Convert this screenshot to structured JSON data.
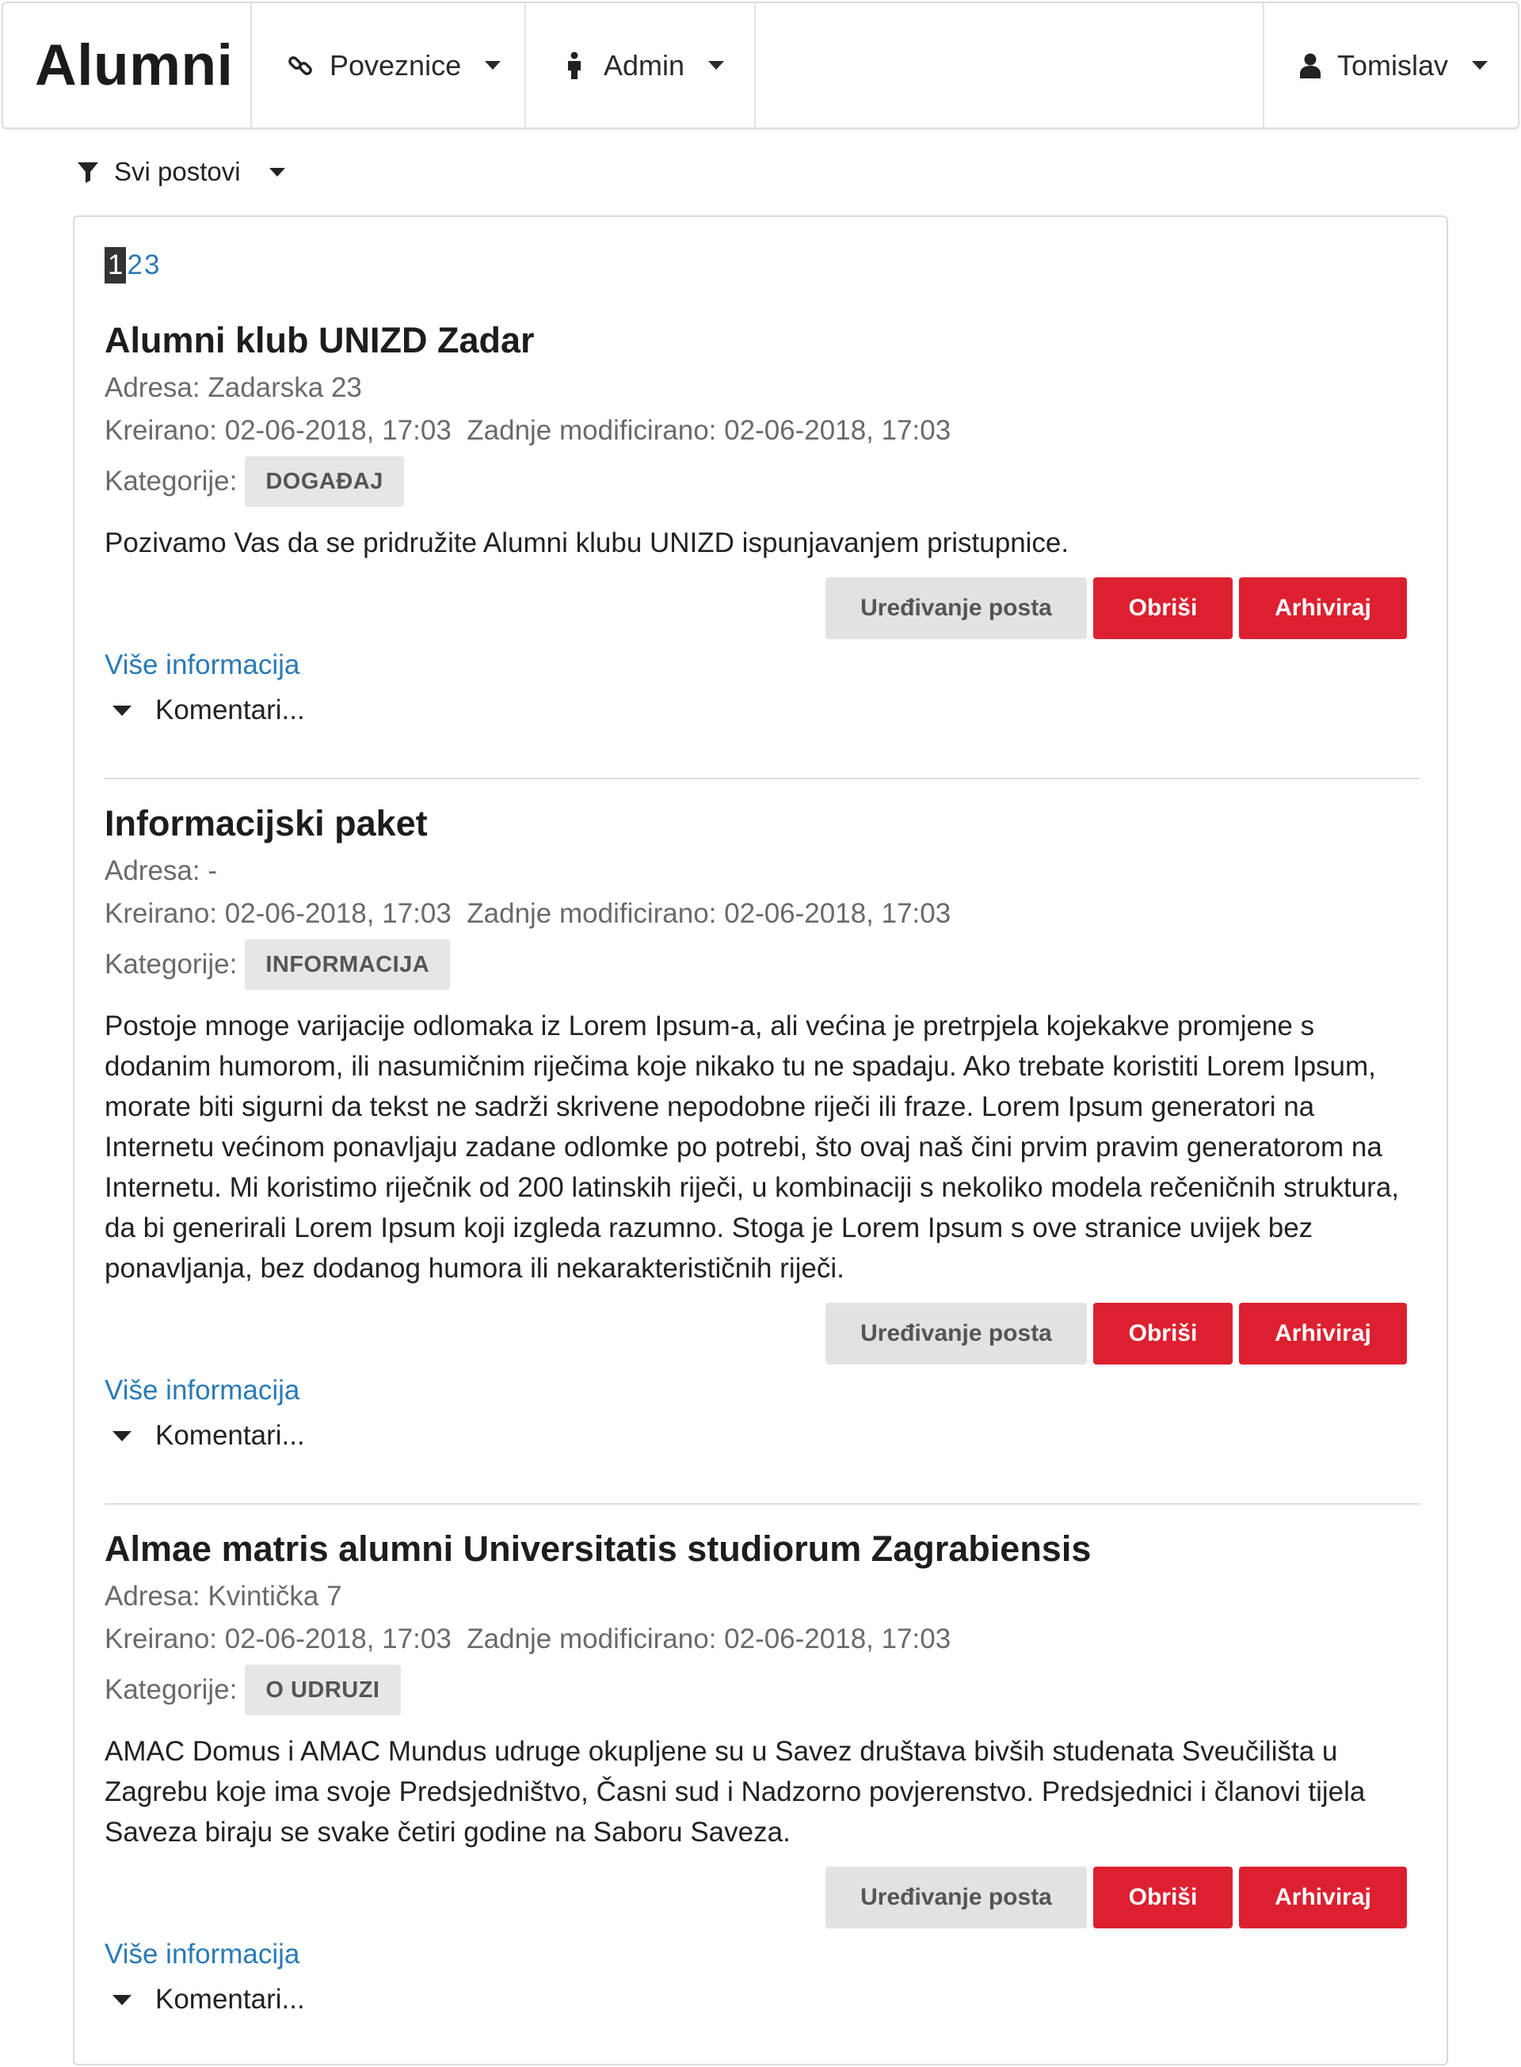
{
  "navbar": {
    "brand": "Alumni",
    "items": [
      {
        "label": "Poveznice",
        "icon": "link-icon"
      },
      {
        "label": "Admin",
        "icon": "person-icon"
      }
    ],
    "user": {
      "label": "Tomislav",
      "icon": "user-icon"
    }
  },
  "filter": {
    "label": "Svi postovi",
    "icon": "filter-icon"
  },
  "pagination": {
    "pages": [
      "1",
      "2",
      "3"
    ],
    "active": "1"
  },
  "labels": {
    "edit": "Uređivanje posta",
    "delete": "Obriši",
    "archive": "Arhiviraj",
    "more": "Više informacija",
    "comments": "Komentari...",
    "categories": "Kategorije:"
  },
  "posts": [
    {
      "title": "Alumni klub UNIZD Zadar",
      "address": "Adresa: Zadarska 23",
      "dates": "Kreirano: 02-06-2018, 17:03  Zadnje modificirano: 02-06-2018, 17:03",
      "category": "DOGAĐAJ",
      "body": "Pozivamo Vas da se pridružite Alumni klubu UNIZD ispunjavanjem pristupnice."
    },
    {
      "title": "Informacijski paket",
      "address": "Adresa: -",
      "dates": "Kreirano: 02-06-2018, 17:03  Zadnje modificirano: 02-06-2018, 17:03",
      "category": "INFORMACIJA",
      "body": "Postoje mnoge varijacije odlomaka iz Lorem Ipsum-a, ali većina je pretrpjela kojekakve promjene s dodanim humorom, ili nasumičnim riječima koje nikako tu ne spadaju. Ako trebate koristiti Lorem Ipsum, morate biti sigurni da tekst ne sadrži skrivene nepodobne riječi ili fraze. Lorem Ipsum generatori na Internetu većinom ponavljaju zadane odlomke po potrebi, što ovaj naš čini prvim pravim generatorom na Internetu. Mi koristimo riječnik od 200 latinskih riječi, u kombinaciji s nekoliko modela rečeničnih struktura, da bi generirali Lorem Ipsum koji izgleda razumno. Stoga je Lorem Ipsum s ove stranice uvijek bez ponavljanja, bez dodanog humora ili nekarakterističnih riječi."
    },
    {
      "title": "Almae matris alumni Universitatis studiorum Zagrabiensis",
      "address": "Adresa: Kvintička 7",
      "dates": "Kreirano: 02-06-2018, 17:03  Zadnje modificirano: 02-06-2018, 17:03",
      "category": "O UDRUZI",
      "body": "AMAC Domus i AMAC Mundus udruge okupljene su u Savez društava bivših studenata Sveučilišta u Zagrebu koje ima svoje Predsjedništvo, Časni sud i Nadzorno povjerenstvo. Predsjednici i članovi tijela Saveza biraju se svake četiri godine na Saboru Saveza."
    }
  ]
}
